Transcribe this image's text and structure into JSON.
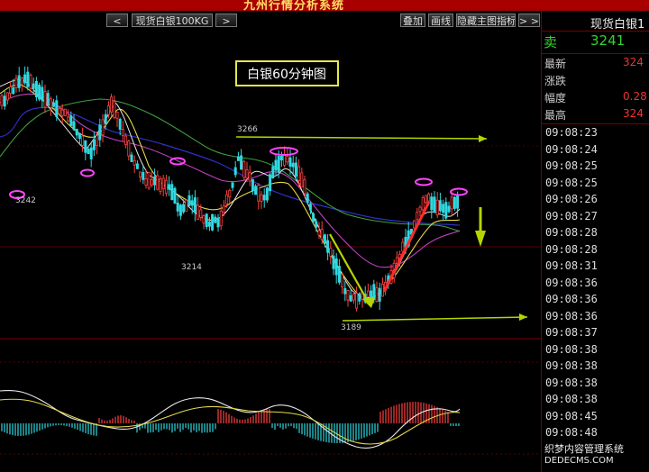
{
  "window": {
    "title": "九州行情分析系统"
  },
  "toolbar": {
    "prev_label": "<",
    "symbol_label": "现货白银100KG",
    "next_label": ">",
    "overlay_label": "叠加",
    "draw_label": "画线",
    "hide_main_label": "隐藏主图指标",
    "more_label": "> >"
  },
  "chart": {
    "title": "白银60分钟图",
    "annotations": {
      "high": "3266",
      "low": "3189",
      "mid_low": "3214",
      "left_low": "3242"
    }
  },
  "quote": {
    "name": "现货白银1",
    "sell_label": "卖",
    "sell_value": "3241",
    "rows": [
      {
        "label": "最新",
        "value": "324"
      },
      {
        "label": "涨跌",
        "value": ""
      },
      {
        "label": "幅度",
        "value": "0.28"
      },
      {
        "label": "最高",
        "value": "324"
      }
    ],
    "ticks": [
      "09:08:23",
      "09:08:24",
      "09:08:25",
      "09:08:25",
      "09:08:26",
      "09:08:27",
      "09:08:28",
      "09:08:28",
      "09:08:31",
      "09:08:36",
      "09:08:36",
      "09:08:36",
      "09:08:37",
      "09:08:38",
      "09:08:38",
      "09:08:38",
      "09:08:38",
      "09:08:45",
      "09:08:48"
    ]
  },
  "watermark": {
    "line1": "织梦内容管理系统",
    "line2": "DEDECMS.COM"
  },
  "colors": {
    "up": "#ff4040",
    "down": "#30d8e0",
    "ma_white": "#e8e8e8",
    "ma_yellow": "#e6d84a",
    "ma_magenta": "#c040c0",
    "ma_green": "#3ea03e",
    "ma_blue": "#3030c8",
    "arrow": "#b6d400",
    "marker": "#ff44ff"
  }
}
